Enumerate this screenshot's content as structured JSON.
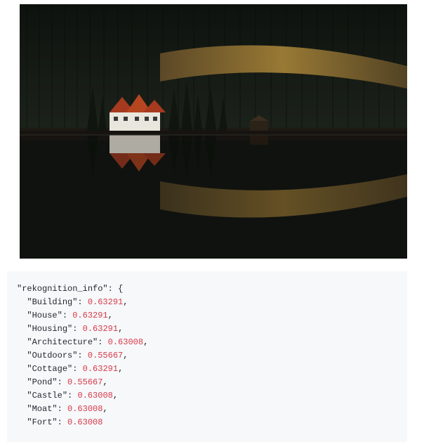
{
  "rekognition_key": "rekognition_info",
  "labels": [
    {
      "name": "Building",
      "confidence": 0.63291
    },
    {
      "name": "House",
      "confidence": 0.63291
    },
    {
      "name": "Housing",
      "confidence": 0.63291
    },
    {
      "name": "Architecture",
      "confidence": 0.63008
    },
    {
      "name": "Outdoors",
      "confidence": 0.55667
    },
    {
      "name": "Cottage",
      "confidence": 0.63291
    },
    {
      "name": "Pond",
      "confidence": 0.55667
    },
    {
      "name": "Castle",
      "confidence": 0.63008
    },
    {
      "name": "Moat",
      "confidence": 0.63008
    },
    {
      "name": "Fort",
      "confidence": 0.63008
    }
  ],
  "image": {
    "description": "A white house with a red roof on the shore of a dark still lake, with a dense dark-green conifer forest rising behind it, some golden/yellow larch trees mid-slope, and a near-perfect mirror reflection in the water."
  }
}
